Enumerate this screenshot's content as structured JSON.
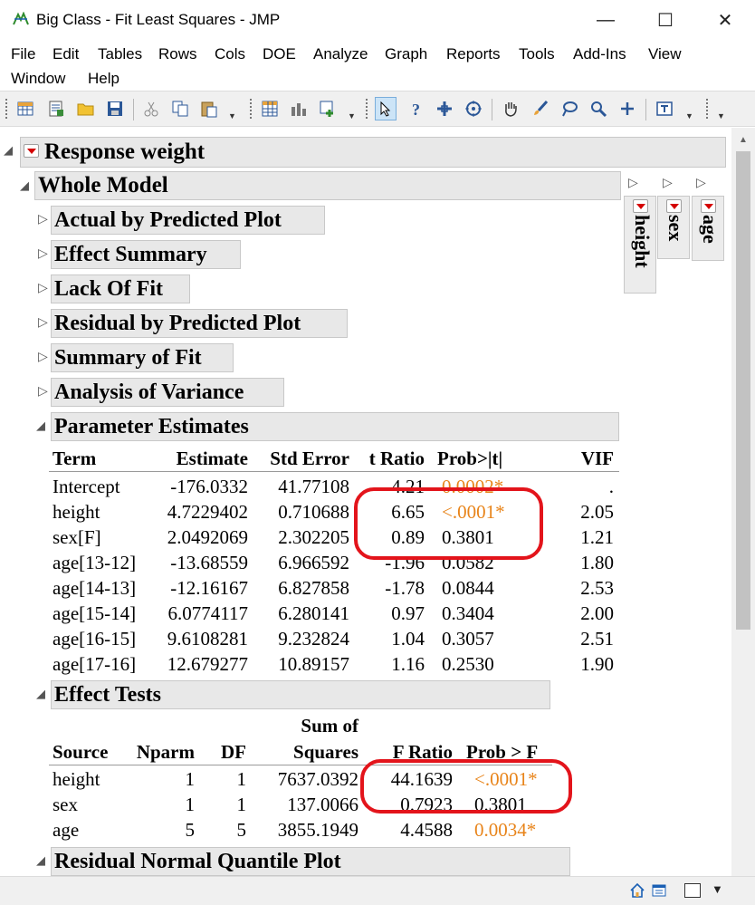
{
  "window": {
    "title": "Big Class - Fit Least Squares - JMP",
    "minimize_glyph": "—",
    "maximize_glyph": "☐",
    "close_glyph": "✕"
  },
  "menu": [
    "File",
    "Edit",
    "Tables",
    "Rows",
    "Cols",
    "DOE",
    "Analyze",
    "Graph",
    "Reports",
    "Tools",
    "Add-Ins",
    "View",
    "Window",
    "Help"
  ],
  "toolbar_icons": [
    "new-data-table-icon",
    "new-script-icon",
    "open-folder-icon",
    "save-icon",
    "cut-icon",
    "copy-icon",
    "paste-icon",
    "data-table-icon",
    "distribution-icon",
    "add-rows-icon",
    "arrow-select-icon",
    "help-icon",
    "crosshair-icon",
    "target-icon",
    "hand-icon",
    "brush-icon",
    "lasso-icon",
    "magnifier-icon",
    "plus-icon",
    "annotate-icon"
  ],
  "report": {
    "response_title": "Response weight",
    "whole_model": "Whole Model",
    "collapsed_sections": [
      "Actual by Predicted Plot",
      "Effect Summary",
      "Lack Of Fit",
      "Residual by Predicted Plot",
      "Summary of Fit",
      "Analysis of Variance"
    ],
    "side_panels": [
      "height",
      "sex",
      "age"
    ],
    "parameter_estimates": {
      "title": "Parameter Estimates",
      "columns": [
        "Term",
        "Estimate",
        "Std Error",
        "t Ratio",
        "Prob>|t|",
        "VIF"
      ],
      "rows": [
        {
          "term": "Intercept",
          "estimate": "-176.0332",
          "std_error": "41.77108",
          "t_ratio": "-4.21",
          "prob": "0.0002*",
          "vif": ".",
          "signif": true
        },
        {
          "term": "height",
          "estimate": "4.7229402",
          "std_error": "0.710688",
          "t_ratio": "6.65",
          "prob": "<.0001*",
          "vif": "2.05",
          "signif": true
        },
        {
          "term": "sex[F]",
          "estimate": "2.0492069",
          "std_error": "2.302205",
          "t_ratio": "0.89",
          "prob": "0.3801",
          "vif": "1.21",
          "signif": false
        },
        {
          "term": "age[13-12]",
          "estimate": "-13.68559",
          "std_error": "6.966592",
          "t_ratio": "-1.96",
          "prob": "0.0582",
          "vif": "1.80",
          "signif": false
        },
        {
          "term": "age[14-13]",
          "estimate": "-12.16167",
          "std_error": "6.827858",
          "t_ratio": "-1.78",
          "prob": "0.0844",
          "vif": "2.53",
          "signif": false
        },
        {
          "term": "age[15-14]",
          "estimate": "6.0774117",
          "std_error": "6.280141",
          "t_ratio": "0.97",
          "prob": "0.3404",
          "vif": "2.00",
          "signif": false
        },
        {
          "term": "age[16-15]",
          "estimate": "9.6108281",
          "std_error": "9.232824",
          "t_ratio": "1.04",
          "prob": "0.3057",
          "vif": "2.51",
          "signif": false
        },
        {
          "term": "age[17-16]",
          "estimate": "12.679277",
          "std_error": "10.89157",
          "t_ratio": "1.16",
          "prob": "0.2530",
          "vif": "1.90",
          "signif": false
        }
      ]
    },
    "effect_tests": {
      "title": "Effect Tests",
      "header_top": "Sum of",
      "columns": [
        "Source",
        "Nparm",
        "DF",
        "Squares",
        "F Ratio",
        "Prob > F"
      ],
      "rows": [
        {
          "source": "height",
          "nparm": "1",
          "df": "1",
          "ss": "7637.0392",
          "f_ratio": "44.1639",
          "prob": "<.0001*",
          "signif": true
        },
        {
          "source": "sex",
          "nparm": "1",
          "df": "1",
          "ss": "137.0066",
          "f_ratio": "0.7923",
          "prob": "0.3801",
          "signif": false
        },
        {
          "source": "age",
          "nparm": "5",
          "df": "5",
          "ss": "3855.1949",
          "f_ratio": "4.4588",
          "prob": "0.0034*",
          "signif": true
        }
      ]
    },
    "residual_plot_title": "Residual Normal Quantile Plot"
  },
  "colors": {
    "significant": "#e8841a",
    "annotation_red": "#e3141b",
    "header_bg": "#e8e8e8",
    "disclosure_red": "#d40000"
  }
}
